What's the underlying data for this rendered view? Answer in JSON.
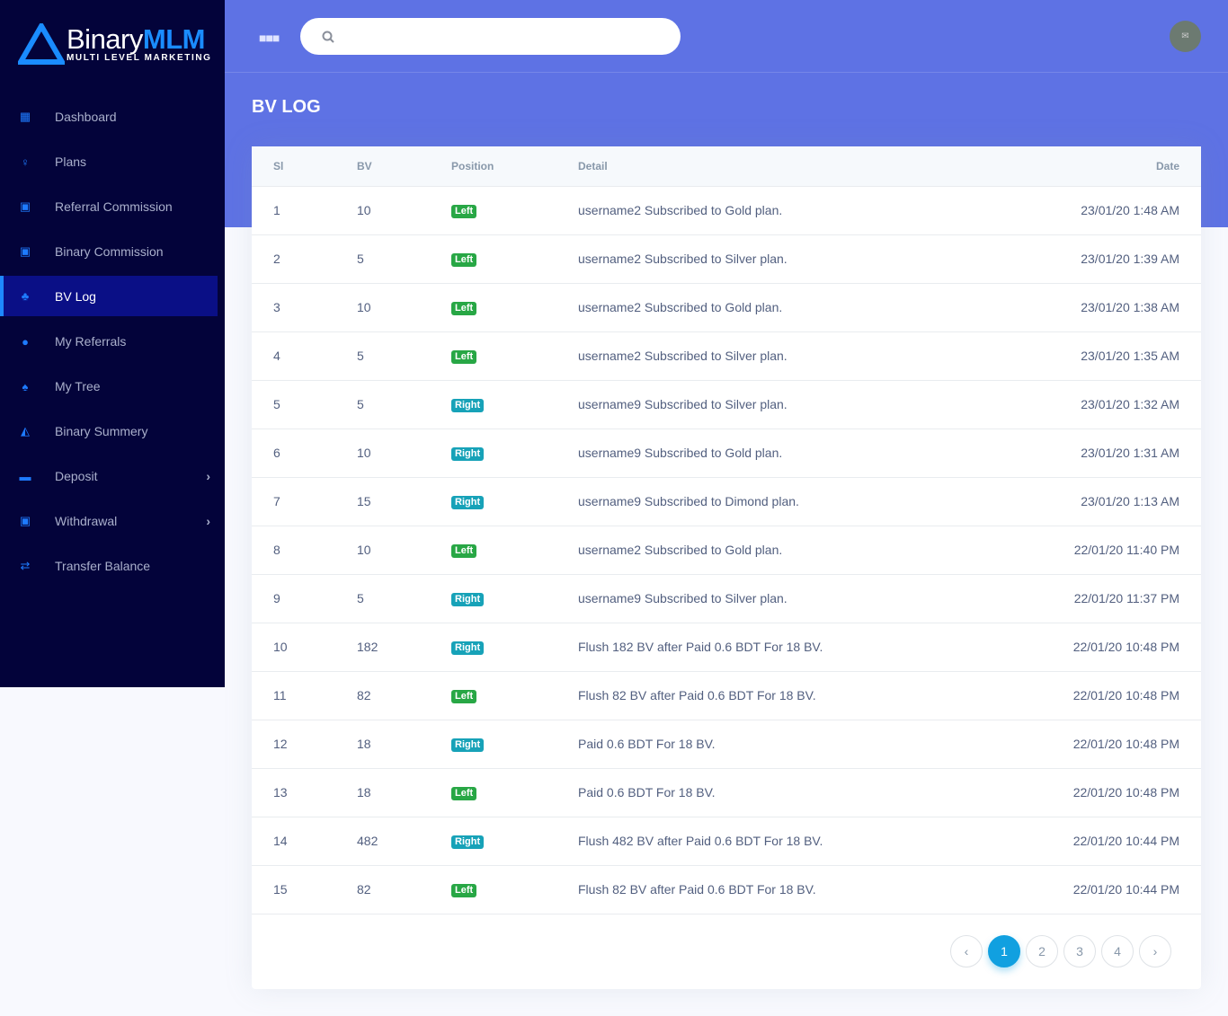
{
  "brand": {
    "name_a": "Binary",
    "name_b": "MLM",
    "tagline": "MULTI LEVEL MARKETING",
    "accent": "#1a8cff"
  },
  "sidebar": {
    "items": [
      {
        "label": "Dashboard",
        "icon": "dashboard-icon"
      },
      {
        "label": "Plans",
        "icon": "lightbulb-icon"
      },
      {
        "label": "Referral Commission",
        "icon": "money-icon"
      },
      {
        "label": "Binary Commission",
        "icon": "money-icon"
      },
      {
        "label": "BV Log",
        "icon": "sitemap-icon",
        "active": true
      },
      {
        "label": "My Referrals",
        "icon": "users-icon"
      },
      {
        "label": "My Tree",
        "icon": "tree-icon"
      },
      {
        "label": "Binary Summery",
        "icon": "area-chart-icon"
      },
      {
        "label": "Deposit",
        "icon": "credit-card-icon",
        "submenu": true
      },
      {
        "label": "Withdrawal",
        "icon": "money-icon",
        "submenu": true
      },
      {
        "label": "Transfer Balance",
        "icon": "exchange-icon"
      }
    ]
  },
  "header": {
    "search_placeholder": ""
  },
  "page": {
    "title": "BV LOG"
  },
  "table": {
    "columns": [
      "Sl",
      "BV",
      "Position",
      "Detail",
      "Date"
    ],
    "rows": [
      [
        "1",
        "10",
        "Left",
        "username2 Subscribed to Gold plan.",
        "23/01/20 1:48 AM"
      ],
      [
        "2",
        "5",
        "Left",
        "username2 Subscribed to Silver plan.",
        "23/01/20 1:39 AM"
      ],
      [
        "3",
        "10",
        "Left",
        "username2 Subscribed to Gold plan.",
        "23/01/20 1:38 AM"
      ],
      [
        "4",
        "5",
        "Left",
        "username2 Subscribed to Silver plan.",
        "23/01/20 1:35 AM"
      ],
      [
        "5",
        "5",
        "Right",
        "username9 Subscribed to Silver plan.",
        "23/01/20 1:32 AM"
      ],
      [
        "6",
        "10",
        "Right",
        "username9 Subscribed to Gold plan.",
        "23/01/20 1:31 AM"
      ],
      [
        "7",
        "15",
        "Right",
        "username9 Subscribed to Dimond plan.",
        "23/01/20 1:13 AM"
      ],
      [
        "8",
        "10",
        "Left",
        "username2 Subscribed to Gold plan.",
        "22/01/20 11:40 PM"
      ],
      [
        "9",
        "5",
        "Right",
        "username9 Subscribed to Silver plan.",
        "22/01/20 11:37 PM"
      ],
      [
        "10",
        "182",
        "Right",
        "Flush 182 BV after Paid 0.6 BDT For 18 BV.",
        "22/01/20 10:48 PM"
      ],
      [
        "11",
        "82",
        "Left",
        "Flush 82 BV after Paid 0.6 BDT For 18 BV.",
        "22/01/20 10:48 PM"
      ],
      [
        "12",
        "18",
        "Right",
        "Paid 0.6 BDT For 18 BV.",
        "22/01/20 10:48 PM"
      ],
      [
        "13",
        "18",
        "Left",
        "Paid 0.6 BDT For 18 BV.",
        "22/01/20 10:48 PM"
      ],
      [
        "14",
        "482",
        "Right",
        "Flush 482 BV after Paid 0.6 BDT For 18 BV.",
        "22/01/20 10:44 PM"
      ],
      [
        "15",
        "82",
        "Left",
        "Flush 82 BV after Paid 0.6 BDT For 18 BV.",
        "22/01/20 10:44 PM"
      ]
    ]
  },
  "pagination": {
    "prev": "‹",
    "pages": [
      "1",
      "2",
      "3",
      "4"
    ],
    "current": "1",
    "next": "›"
  }
}
